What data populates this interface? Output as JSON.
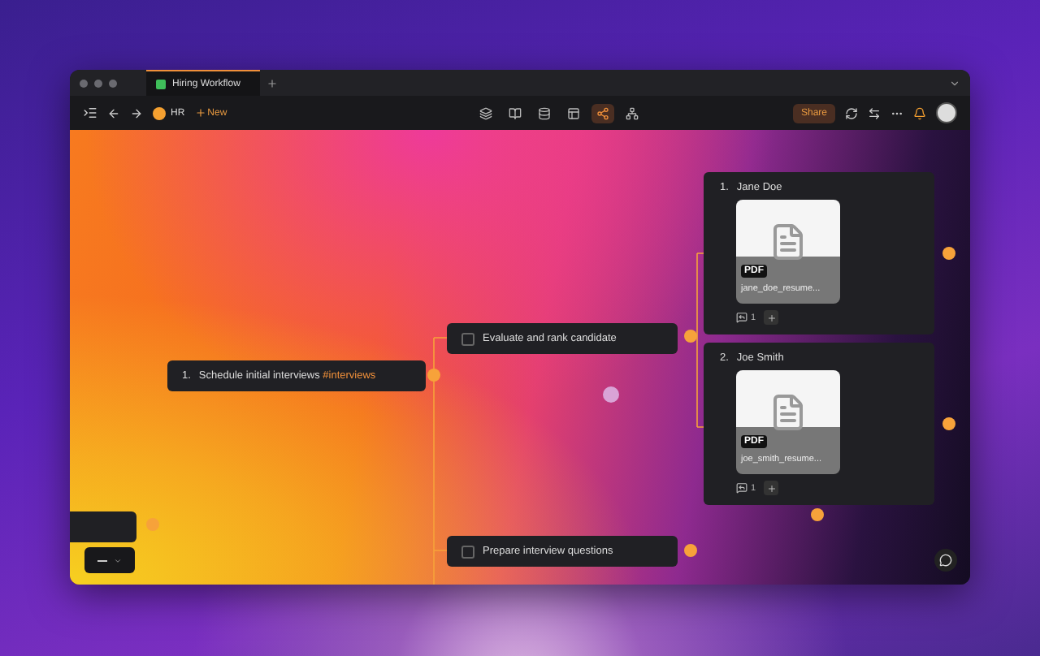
{
  "window": {
    "tabs": [
      {
        "title": "Hiring Workflow",
        "selected": true
      }
    ]
  },
  "toolbar": {
    "workspace": "HR",
    "new_label": "New",
    "view_modes": [
      {
        "selected": false
      },
      {
        "selected": false
      },
      {
        "selected": false
      },
      {
        "selected": false
      },
      {
        "selected": true
      },
      {
        "selected": false
      }
    ],
    "share_label": "Share"
  },
  "root_node": {
    "number": "1.",
    "text": "Schedule initial interviews",
    "tag": "#interviews"
  },
  "tasks": [
    {
      "label": "Evaluate and rank candidate",
      "checked": false
    },
    {
      "label": "Prepare interview questions",
      "checked": false
    }
  ],
  "candidates": [
    {
      "number": "1.",
      "name": "Jane Doe",
      "file_type": "PDF",
      "file_name": "jane_doe_resume...",
      "comments": "1"
    },
    {
      "number": "2.",
      "name": "Joe Smith",
      "file_type": "PDF",
      "file_name": "joe_smith_resume...",
      "comments": "1"
    }
  ]
}
